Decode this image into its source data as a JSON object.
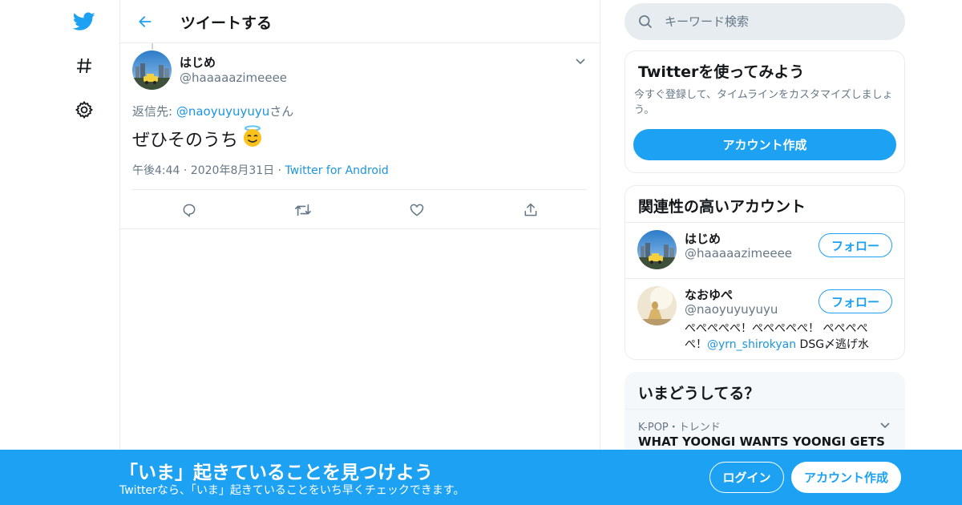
{
  "colors": {
    "accent": "#1da1f2",
    "link": "#1b95e0",
    "muted": "#657786",
    "border": "#e6ecf0"
  },
  "nav": {
    "icons": [
      "twitter-bird-icon",
      "hashtag-icon",
      "gear-icon"
    ]
  },
  "header": {
    "title": "ツイートする"
  },
  "tweet": {
    "name": "はじめ",
    "handle": "@haaaaazimeeee",
    "reply_prefix": "返信先: ",
    "reply_to": "@naoyuyuyuyu",
    "reply_suffix": "さん",
    "text": "ぜひそのうち",
    "emoji": "smiling-face-with-halo",
    "time": "午後4:44",
    "date": "2020年8月31日",
    "source": "Twitter for Android",
    "actions": [
      "reply-icon",
      "retweet-icon",
      "like-icon",
      "share-icon"
    ]
  },
  "search": {
    "placeholder": "キーワード検索"
  },
  "signup_card": {
    "title": "Twitterを使ってみよう",
    "body": "今すぐ登録して、タイムラインをカスタマイズしましょう。",
    "button": "アカウント作成"
  },
  "related": {
    "title": "関連性の高いアカウント",
    "accounts": [
      {
        "name": "はじめ",
        "handle": "@haaaaazimeeee",
        "button": "フォロー"
      },
      {
        "name": "なおゆぺ",
        "handle": "@naoyuyuyuyu",
        "button": "フォロー",
        "bio_pre": "ぺぺぺぺぺ！ぺぺぺぺぺ！ ぺぺぺぺぺ！",
        "bio_link": "@yrn_shirokyan",
        "bio_post": " DSG〆逃げ水"
      }
    ]
  },
  "trends": {
    "title": "いまどうしてる？",
    "items": [
      {
        "context": "K-POP・トレンド",
        "name": "WHAT YOONGI WANTS YOONGI GETS"
      }
    ]
  },
  "banner": {
    "title": "「いま」起きていることを見つけよう",
    "subtitle": "Twitterなら、「いま」起きていることをいち早くチェックできます。",
    "login": "ログイン",
    "signup": "アカウント作成"
  }
}
